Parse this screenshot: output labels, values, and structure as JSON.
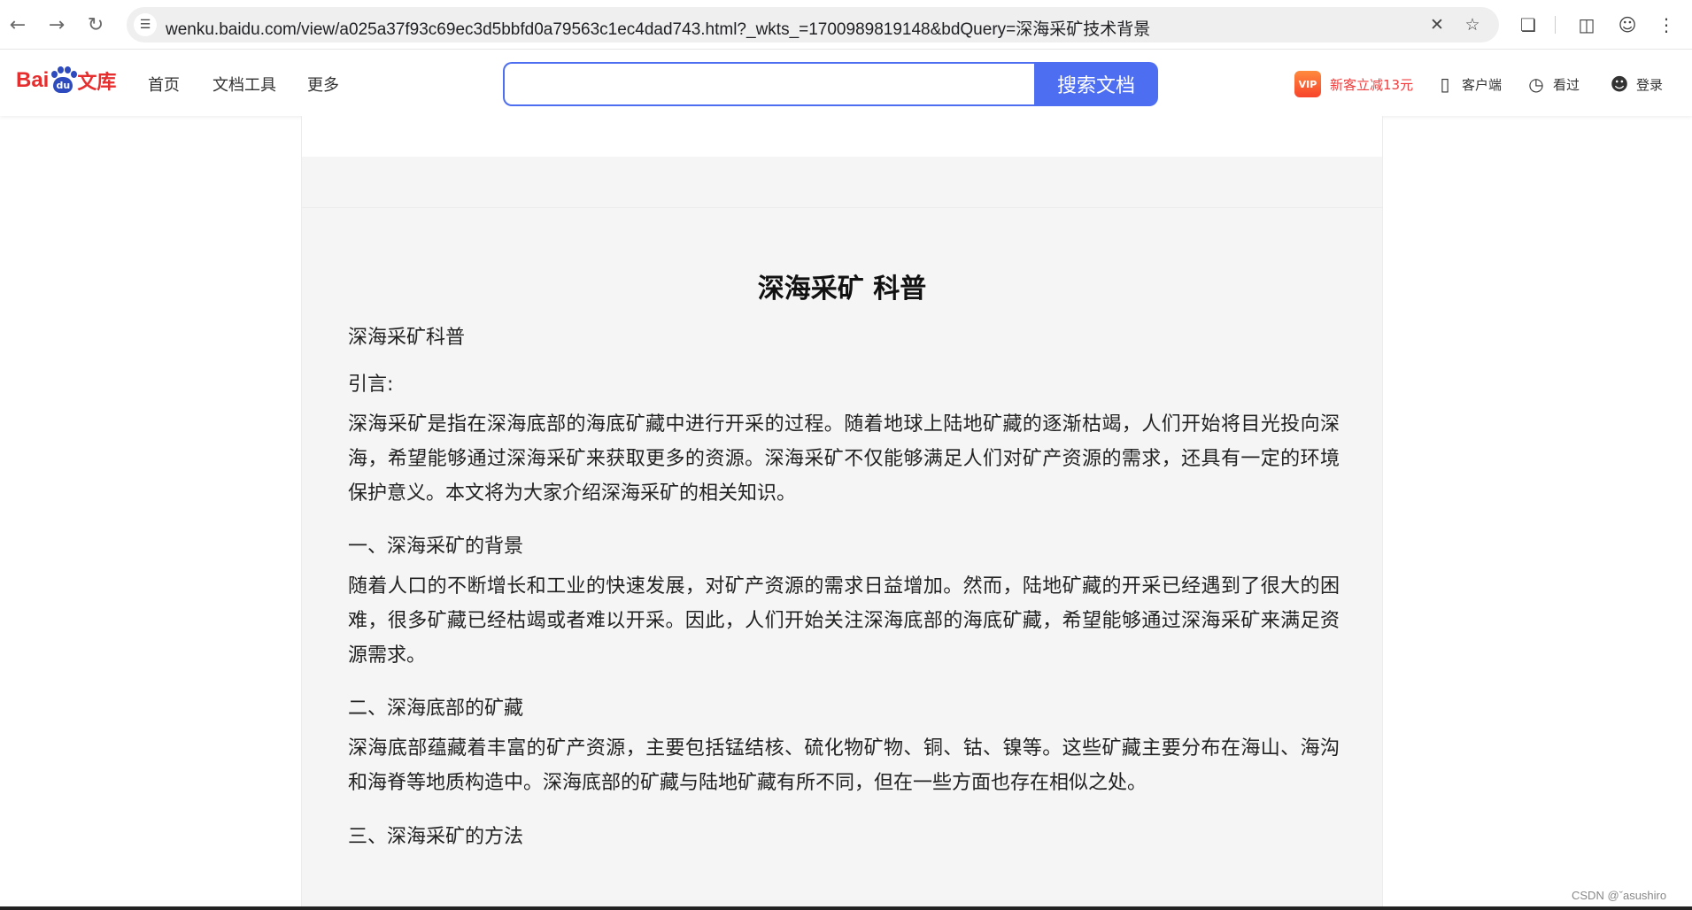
{
  "browser": {
    "url": "wenku.baidu.com/view/a025a37f93c69ec3d5bbfd0a79563c1ec4dad743.html?_wkts_=1700989819148&bdQuery=深海采矿技术背景",
    "back_icon": "arrow-left-icon",
    "forward_icon": "arrow-right-icon",
    "reload_icon": "reload-icon"
  },
  "header": {
    "logo_bai": "Bai",
    "logo_du": "du",
    "logo_wenku": "文库",
    "nav": [
      "首页",
      "文档工具",
      "更多"
    ],
    "search": {
      "placeholder": "",
      "button_label": "搜索文档"
    },
    "promo": {
      "badge": "VIP",
      "text": "新客立减13元"
    },
    "client_label": "客户端",
    "history_label": "看过",
    "login_label": "登录"
  },
  "document": {
    "title": "深海采矿 科普",
    "subtitle": "深海采矿科普",
    "intro_heading": "引言:",
    "paragraph1": "深海采矿是指在深海底部的海底矿藏中进行开采的过程。随着地球上陆地矿藏的逐渐枯竭，人们开始将目光投向深海，希望能够通过深海采矿来获取更多的资源。深海采矿不仅能够满足人们对矿产资源的需求，还具有一定的环境保护意义。本文将为大家介绍深海采矿的相关知识。",
    "section1_heading": "一、深海采矿的背景",
    "paragraph2": "随着人口的不断增长和工业的快速发展，对矿产资源的需求日益增加。然而，陆地矿藏的开采已经遇到了很大的困难，很多矿藏已经枯竭或者难以开采。因此，人们开始关注深海底部的海底矿藏，希望能够通过深海采矿来满足资源需求。",
    "section2_heading": "二、深海底部的矿藏",
    "paragraph3": "深海底部蕴藏着丰富的矿产资源，主要包括锰结核、硫化物矿物、铜、钴、镍等。这些矿藏主要分布在海山、海沟和海脊等地质构造中。深海底部的矿藏与陆地矿藏有所不同，但在一些方面也存在相似之处。",
    "section3_heading": "三、深海采矿的方法"
  },
  "watermark": "CSDN @ˇasushiro"
}
